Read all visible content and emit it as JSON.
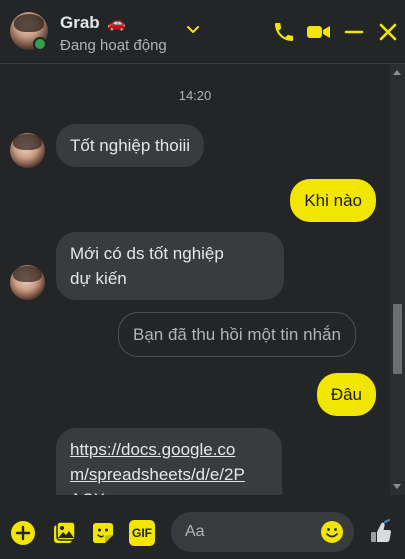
{
  "header": {
    "name": "Grab",
    "name_emoji": "🚗",
    "status": "Đang hoạt động",
    "icons": [
      "chevron-down-icon",
      "phone-icon",
      "video-icon",
      "minimize-icon",
      "close-icon"
    ]
  },
  "conversation": {
    "timestamp": "14:20",
    "messages": [
      {
        "sender": "contact",
        "text": "Tốt nghiệp thoiii"
      },
      {
        "sender": "self",
        "text": "Khi nào"
      },
      {
        "sender": "contact",
        "text_line1": "Mới có ds tốt nghiệp",
        "text_line2": "dự kiến"
      },
      {
        "sender": "contact",
        "text": "Bạn đã thu hồi một tin nhắn",
        "recalled": true
      },
      {
        "sender": "self",
        "text": "Đâu"
      },
      {
        "sender": "contact",
        "link_line1": "https://docs.google.co",
        "link_line2": "m/spreadsheets/d/e/2P",
        "link_line3": "ACX-"
      }
    ]
  },
  "composer": {
    "placeholder": "Aa",
    "gif_label": "GIF",
    "icons": [
      "plus-icon",
      "image-icon",
      "sticker-icon",
      "gif-icon",
      "emoji-icon",
      "thumbs-up-icon"
    ]
  },
  "colors": {
    "accent": "#f2e500",
    "background": "#242526",
    "incoming_bubble": "#3a3b3c",
    "online": "#31a24c"
  }
}
